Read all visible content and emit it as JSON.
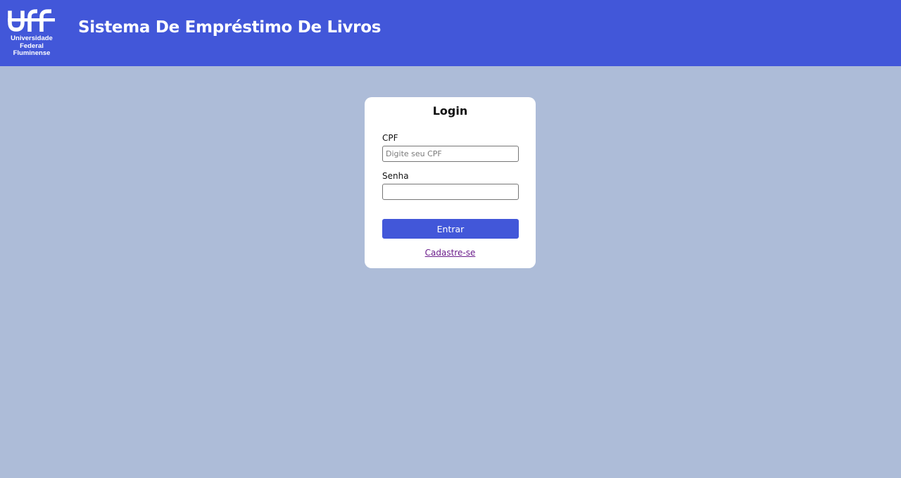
{
  "header": {
    "logo": {
      "icon": "uff-logo-icon",
      "lines": [
        "Universidade",
        "Federal",
        "Fluminense"
      ]
    },
    "title": "Sistema De Empréstimo De Livros"
  },
  "login": {
    "title": "Login",
    "cpf_label": "CPF",
    "cpf_placeholder": "Digite seu CPF",
    "cpf_value": "",
    "senha_label": "Senha",
    "senha_value": "",
    "submit_label": "Entrar",
    "signup_label": "Cadastre-se"
  },
  "colors": {
    "header_bg": "#4257d9",
    "page_bg": "#adbcd8",
    "card_bg": "#ffffff",
    "button_bg": "#4257d9",
    "link": "#6a1c8a"
  }
}
